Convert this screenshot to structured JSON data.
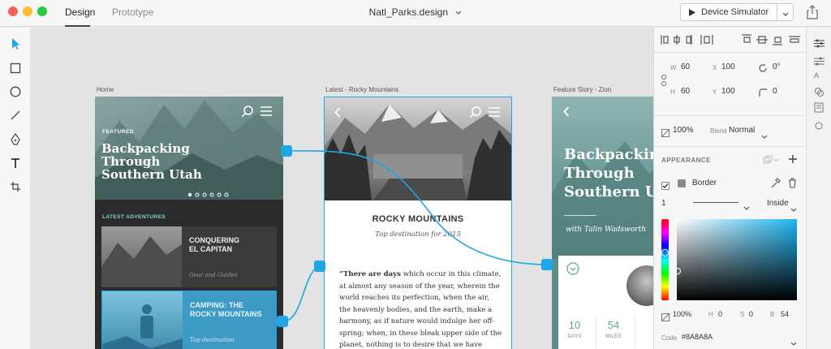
{
  "titlebar": {
    "tabs": [
      {
        "label": "Design",
        "active": true
      },
      {
        "label": "Prototype",
        "active": false
      }
    ],
    "document_title": "Natl_Parks.design",
    "simulator_label": "Device Simulator"
  },
  "artboards": {
    "home": {
      "label": "Home",
      "tag": "FEATURED",
      "headline": [
        "Backpacking",
        "Through",
        "Southern Utah"
      ],
      "section_title": "LATEST ADVENTURES",
      "cards": [
        {
          "title": [
            "CONQUERING",
            "EL CAPITAN"
          ],
          "subtitle": "Gear and Guides"
        },
        {
          "title": [
            "CAMPING: THE",
            "ROCKY MOUNTAINS"
          ],
          "subtitle": "Top destination"
        }
      ]
    },
    "rocky": {
      "label": "Latest - Rocky Mountains",
      "title": "ROCKY MOUNTAINS",
      "subtitle": "Top destination for 2015",
      "body_lead": "“There are days",
      "body_lines": [
        " which occur in this climate,",
        "at almost any season of the year, wherein the",
        "world reaches its perfection, when the air,",
        "the heavenly bodies, and the earth, make a",
        "harmony, as if nature would indulge her off-",
        "spring; when, in these bleak upper side of the",
        "planet, nothing is to desire that we have"
      ]
    },
    "zion": {
      "label": "Feature Story - Zion",
      "headline": [
        "Backpacking",
        "Through",
        "Southern Utah"
      ],
      "byline": "with Talin Wadsworth",
      "stats": [
        {
          "value": "10",
          "label": "DAYS"
        },
        {
          "value": "54",
          "label": "MILES"
        }
      ]
    }
  },
  "properties": {
    "w": "60",
    "x": "100",
    "rotation": "0°",
    "h": "60",
    "y": "100",
    "radius": "0",
    "opacity": "100%",
    "blend_label": "Blend",
    "blend_value": "Normal",
    "appearance_title": "APPEARANCE",
    "border_label": "Border",
    "border_width": "1",
    "border_position": "Inside",
    "color_alpha": "100%",
    "h_label": "H",
    "h_value": "0",
    "s_label": "S",
    "s_value": "0",
    "b_label": "B",
    "b_value": "54",
    "code_label": "Code",
    "code_value": "#8A8A8A"
  },
  "colors": {
    "accent": "#1ea6e6",
    "dark_card": "#2f2f2f",
    "teal": "#5ca4a0"
  }
}
